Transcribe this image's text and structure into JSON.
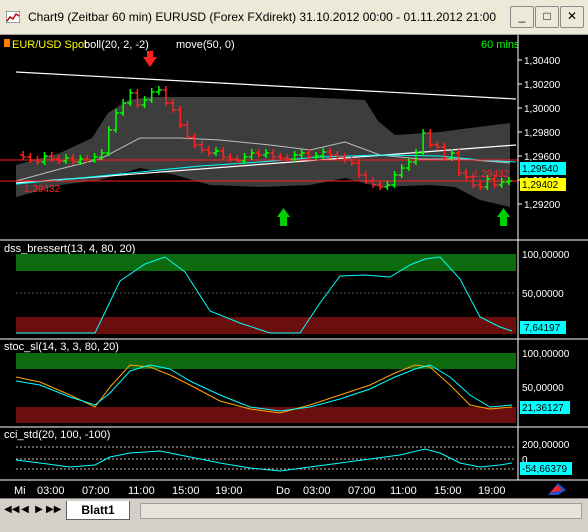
{
  "window": {
    "title": "Chart9 (Zeitbar 60 min)  EURUSD (Forex FXdirekt) 31.10.2012 00:00 - 01.11.2012 21:00",
    "minimize": "_",
    "maximize": "□",
    "close": "✕"
  },
  "main_panel": {
    "legend_symbol": "EUR/USD Spot",
    "legend_boll": "boll(20, 2, -2)",
    "legend_move": "move(50, 0)",
    "interval": "60 mins",
    "price_ticks": [
      "1,30400",
      "1,30200",
      "1,30000",
      "1,29800",
      "1,29600",
      "1,29400",
      "1,29200"
    ],
    "badge_1": "1,29540",
    "badge_2": "1,29402",
    "hline_left_label": "1,29432",
    "hline_right_label": "1,29432"
  },
  "dss_panel": {
    "label": "dss_bressert(13, 4, 80, 20)",
    "ticks": [
      "100,00000",
      "50,00000"
    ],
    "value_badge": "7,64197"
  },
  "stoc_panel": {
    "label": "stoc_sl(14, 3, 3, 80, 20)",
    "ticks": [
      "100,00000",
      "50,00000"
    ],
    "value_badge": "21,36127"
  },
  "cci_panel": {
    "label": "cci_std(20, 100, -100)",
    "ticks": [
      "200,00000",
      "0"
    ],
    "value_badge": "-54,66379"
  },
  "time_axis": [
    "Mi",
    "03:00",
    "07:00",
    "11:00",
    "15:00",
    "19:00",
    "Do",
    "03:00",
    "07:00",
    "11:00",
    "15:00",
    "19:00"
  ],
  "sheet_tab": "Blatt1",
  "nav": [
    "◀◀",
    "◀",
    "▶",
    "▶▶"
  ],
  "colors": {
    "accent_cyan": "#00ffff",
    "accent_yellow": "#ffff00",
    "up_candle": "#00ff00",
    "down_candle": "#ff0000"
  }
}
